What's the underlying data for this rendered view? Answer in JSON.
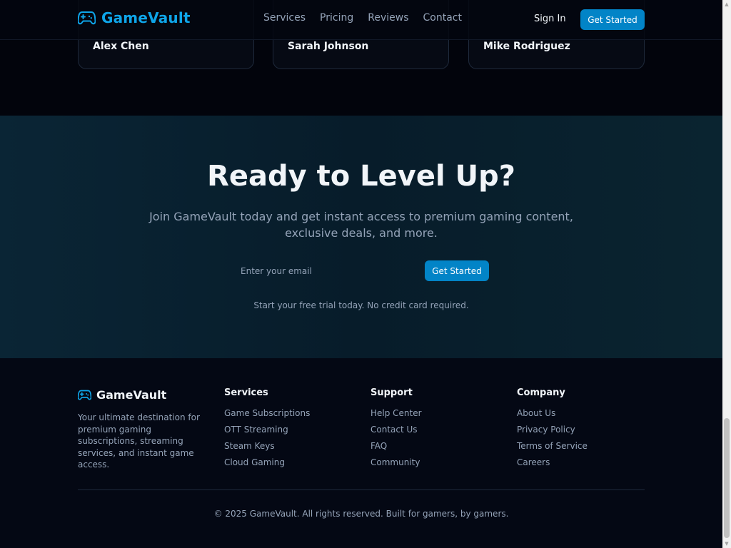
{
  "header": {
    "brand": "GameVault",
    "nav": [
      "Services",
      "Pricing",
      "Reviews",
      "Contact"
    ],
    "sign_in": "Sign In",
    "cta": "Get Started",
    "icon": "gamepad-icon"
  },
  "testimonials": {
    "cards": [
      {
        "author": "Alex Chen",
        "quote_tail": ""
      },
      {
        "author": "Sarah Johnson",
        "quote_tail": ""
      },
      {
        "author": "Mike Rodriguez",
        "quote_tail": ""
      }
    ]
  },
  "cta": {
    "title": "Ready to Level Up?",
    "subtitle": "Join GameVault today and get instant access to premium gaming content, exclusive deals, and more.",
    "email_placeholder": "Enter your email",
    "button": "Get Started",
    "note": "Start your free trial today. No credit card required."
  },
  "footer": {
    "brand": "GameVault",
    "description": "Your ultimate destination for premium gaming subscriptions, streaming services, and instant game access.",
    "columns": [
      {
        "title": "Services",
        "links": [
          "Game Subscriptions",
          "OTT Streaming",
          "Steam Keys",
          "Cloud Gaming"
        ]
      },
      {
        "title": "Support",
        "links": [
          "Help Center",
          "Contact Us",
          "FAQ",
          "Community"
        ]
      },
      {
        "title": "Company",
        "links": [
          "About Us",
          "Privacy Policy",
          "Terms of Service",
          "Careers"
        ]
      }
    ],
    "copyright": "© 2025 GameVault. All rights reserved. Built for gamers, by gamers."
  },
  "colors": {
    "accent": "#0284c7",
    "brand_text": "#0ea5e9",
    "background": "#020617",
    "muted_text": "#94a3b8"
  }
}
